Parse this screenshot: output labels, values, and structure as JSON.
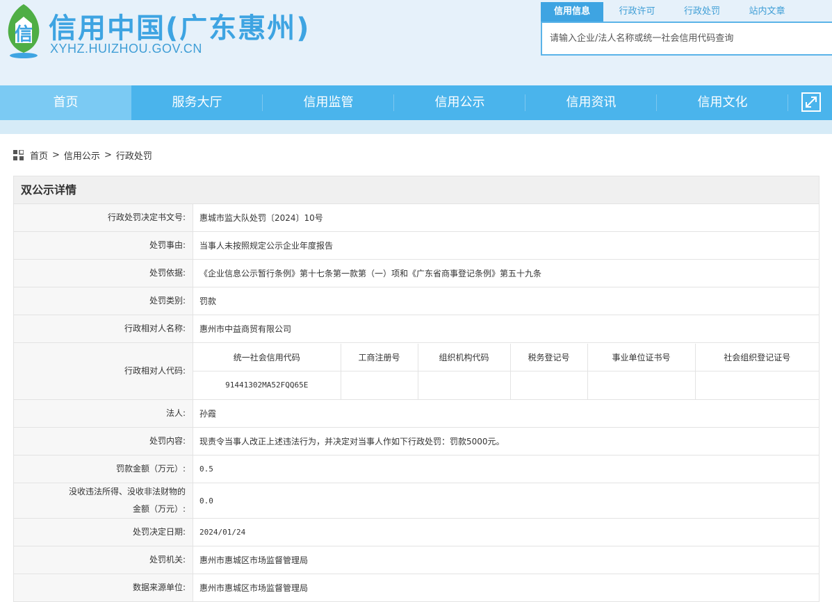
{
  "site": {
    "title": "信用中国(广东惠州)",
    "url": "XYHZ.HUIZHOU.GOV.CN",
    "logo_char": "信"
  },
  "search": {
    "tabs": [
      {
        "label": "信用信息",
        "active": true
      },
      {
        "label": "行政许可",
        "active": false
      },
      {
        "label": "行政处罚",
        "active": false
      },
      {
        "label": "站内文章",
        "active": false
      }
    ],
    "placeholder": "请输入企业/法人名称或统一社会信用代码查询"
  },
  "nav": {
    "items": [
      {
        "label": "首页",
        "active": true
      },
      {
        "label": "服务大厅",
        "active": false
      },
      {
        "label": "信用监管",
        "active": false
      },
      {
        "label": "信用公示",
        "active": false
      },
      {
        "label": "信用资讯",
        "active": false
      },
      {
        "label": "信用文化",
        "active": false
      }
    ],
    "expand_icon": "expand-icon"
  },
  "breadcrumb": {
    "icon": "grid-icon",
    "items": [
      "首页",
      "信用公示",
      "行政处罚"
    ],
    "separator": ">"
  },
  "detail": {
    "title": "双公示详情",
    "rows": {
      "decision_no": {
        "label": "行政处罚决定书文号:",
        "value": "惠城市监大队处罚〔2024〕10号"
      },
      "reason": {
        "label": "处罚事由:",
        "value": "当事人未按照规定公示企业年度报告"
      },
      "basis": {
        "label": "处罚依据:",
        "value": "《企业信息公示暂行条例》第十七条第一款第（一）项和《广东省商事登记条例》第五十九条"
      },
      "category": {
        "label": "处罚类别:",
        "value": "罚款"
      },
      "party_name": {
        "label": "行政相对人名称:",
        "value": "惠州市中益商贸有限公司"
      },
      "party_code": {
        "label": "行政相对人代码:",
        "columns": [
          "统一社会信用代码",
          "工商注册号",
          "组织机构代码",
          "税务登记号",
          "事业单位证书号",
          "社会组织登记证号"
        ],
        "values": [
          "91441302MA52FQQ65E",
          "",
          "",
          "",
          "",
          ""
        ]
      },
      "legal_person": {
        "label": "法人:",
        "value": "孙霞"
      },
      "content": {
        "label": "处罚内容:",
        "value": "现责令当事人改正上述违法行为，并决定对当事人作如下行政处罚：罚款5000元。"
      },
      "fine_amount": {
        "label": "罚款金额（万元）:",
        "value": "0.5"
      },
      "confiscation": {
        "label_line1": "没收违法所得、没收非法财物的",
        "label_line2": "金额（万元）:",
        "value": "0.0"
      },
      "decision_date": {
        "label": "处罚决定日期:",
        "value": "2024/01/24"
      },
      "authority": {
        "label": "处罚机关:",
        "value": "惠州市惠城区市场监督管理局"
      },
      "data_source": {
        "label": "数据来源单位:",
        "value": "惠州市惠城区市场监督管理局"
      }
    }
  },
  "colors": {
    "brand": "#3ea4e2",
    "nav_bg": "#4ab4ec",
    "nav_active": "#7bcaf3",
    "header_bg": "#e6f1fa"
  }
}
